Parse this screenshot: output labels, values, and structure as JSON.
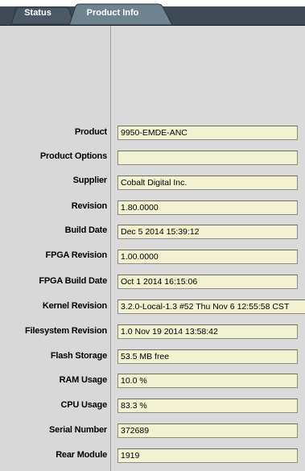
{
  "tabs": [
    {
      "label": "Status",
      "active": false
    },
    {
      "label": "Product Info",
      "active": true
    }
  ],
  "colors": {
    "tab_bar": "#3d4a56",
    "tab_active": "#6f8290",
    "field_bg": "#f2f1d2",
    "panel_bg": "#d6d6d6"
  },
  "fields": [
    {
      "label": "Product",
      "value": "9950-EMDE-ANC"
    },
    {
      "label": "Product Options",
      "value": ""
    },
    {
      "label": "Supplier",
      "value": "Cobalt Digital Inc."
    },
    {
      "label": "Revision",
      "value": "1.80.0000"
    },
    {
      "label": "Build Date",
      "value": "Dec  5 2014 15:39:12"
    },
    {
      "label": "FPGA Revision",
      "value": "1.00.0000"
    },
    {
      "label": "FPGA Build Date",
      "value": "Oct  1 2014 16:15:06"
    },
    {
      "label": "Kernel Revision",
      "value": "3.2.0-Local-1.3 #52 Thu Nov 6 12:55:58 CST"
    },
    {
      "label": "Filesystem Revision",
      "value": "1.0 Nov 19 2014 13:58:42"
    },
    {
      "label": "Flash Storage",
      "value": "53.5 MB free"
    },
    {
      "label": "RAM Usage",
      "value": "10.0 %"
    },
    {
      "label": "CPU Usage",
      "value": "83.3 %"
    },
    {
      "label": "Serial Number",
      "value": "372689"
    },
    {
      "label": "Rear Module",
      "value": "1919"
    }
  ]
}
